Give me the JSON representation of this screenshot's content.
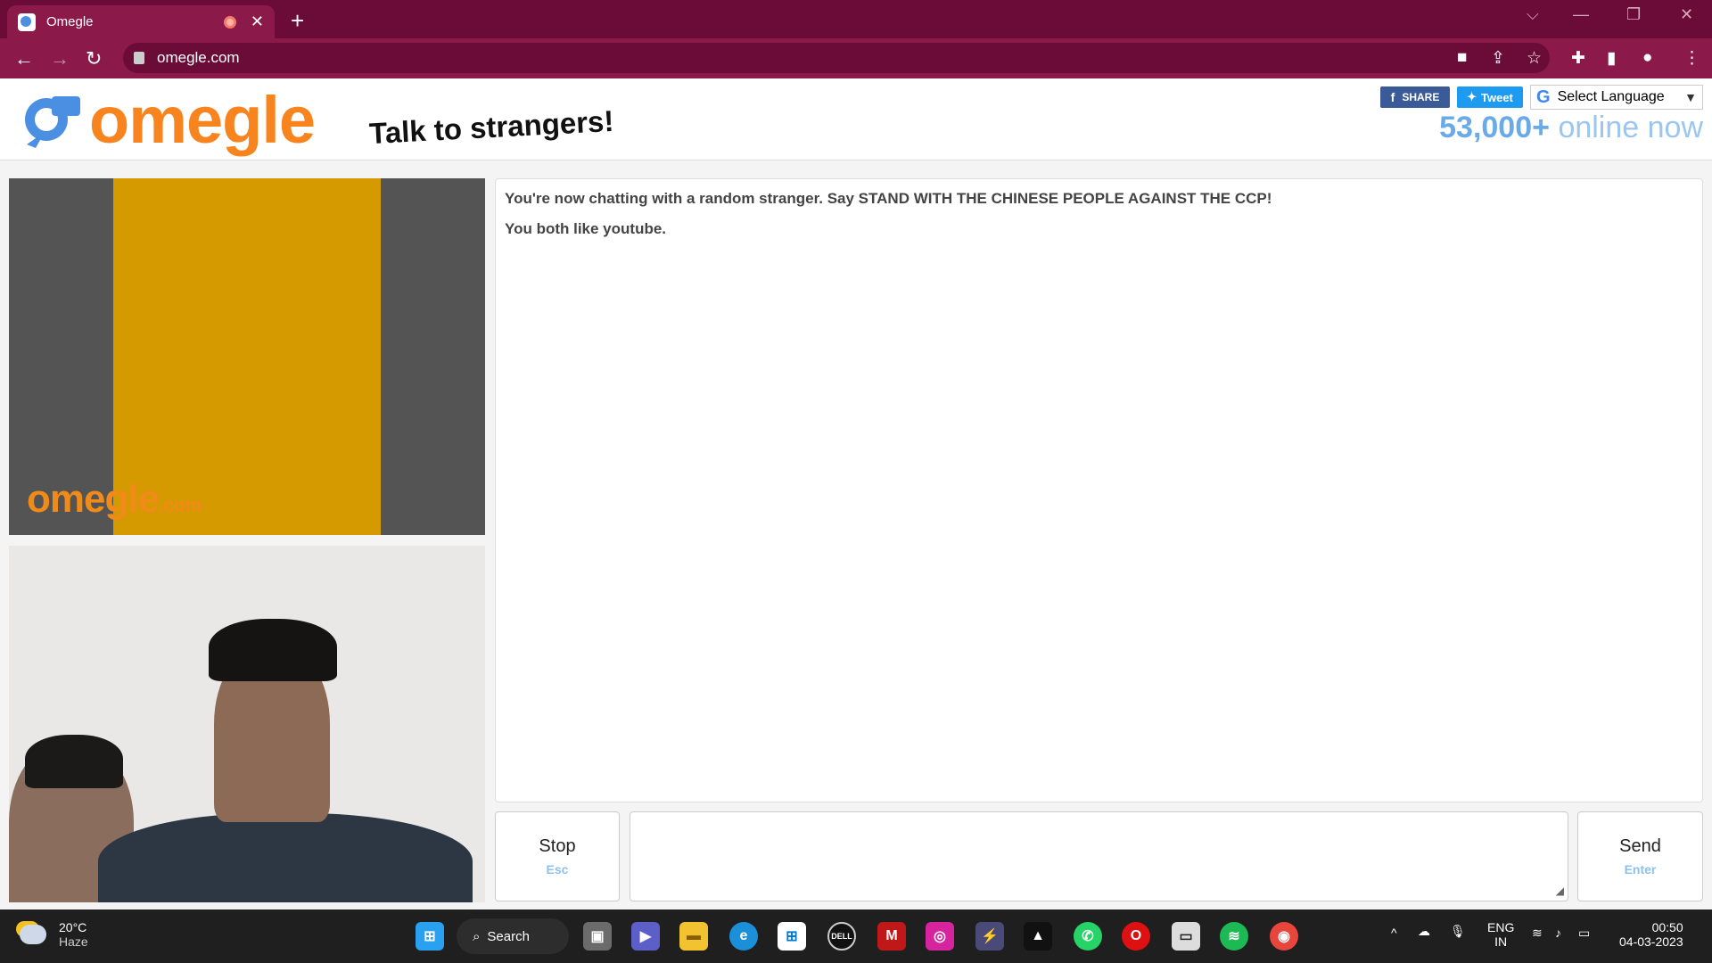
{
  "browser": {
    "tab_title": "Omegle",
    "tab_close": "✕",
    "new_tab": "+",
    "url": "omegle.com",
    "icons": [
      "back-arrow-icon",
      "forward-arrow-icon",
      "reload-icon",
      "lock-icon",
      "camera-icon",
      "share-icon",
      "star-icon",
      "puzzle-icon",
      "sidepanel-icon",
      "profile-icon",
      "kebab-menu-icon"
    ],
    "window_controls": {
      "tabsearch": "⌵",
      "minimize": "—",
      "restore": "❐",
      "close": "✕"
    }
  },
  "header": {
    "logo_text": "omegle",
    "tagline": "Talk to strangers!",
    "share_fb": "SHARE",
    "share_tw": "Tweet",
    "language_label": "Select Language",
    "language_arrow": "▼",
    "online_count": "53,000+",
    "online_suffix": "online now"
  },
  "video": {
    "watermark": "omegle",
    "watermark_suffix": ".com"
  },
  "chat": {
    "messages": [
      "You're now chatting with a random stranger. Say STAND WITH THE CHINESE PEOPLE AGAINST THE CCP!",
      "You both like youtube."
    ],
    "stop_label": "Stop",
    "stop_hint": "Esc",
    "send_label": "Send",
    "send_hint": "Enter",
    "message_value": ""
  },
  "taskbar": {
    "temperature": "20°C",
    "weather": "Haze",
    "search_label": "Search",
    "apps": [
      "windows-start-icon",
      "task-view-icon",
      "meet-icon",
      "file-explorer-icon",
      "edge-icon",
      "store-icon",
      "dell-icon",
      "mcafee-icon",
      "instagram-icon",
      "power-automate-icon",
      "arc-icon",
      "whatsapp-icon",
      "opera-icon",
      "photos-icon",
      "spotify-icon",
      "chrome-icon"
    ],
    "lang_top": "ENG",
    "lang_bottom": "IN",
    "time": "00:50",
    "date": "04-03-2023"
  },
  "colors": {
    "chrome_dark": "#6a0c37",
    "chrome": "#8b1a4b",
    "omegle_orange": "#f7841e",
    "online_blue": "#6aaae8"
  }
}
